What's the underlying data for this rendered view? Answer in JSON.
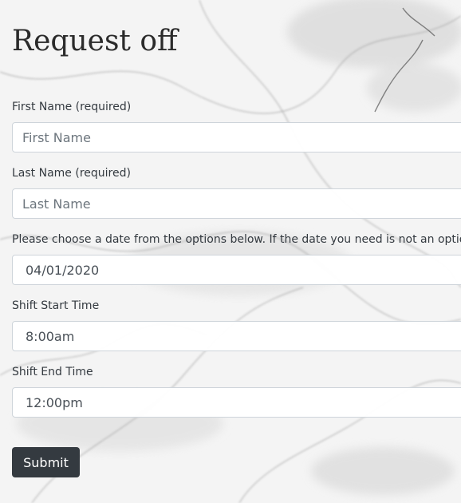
{
  "page": {
    "title": "Request off"
  },
  "form": {
    "first_name": {
      "label": "First Name (required)",
      "placeholder": "First Name",
      "value": ""
    },
    "last_name": {
      "label": "Last Name (required)",
      "placeholder": "Last Name",
      "value": ""
    },
    "date": {
      "label": "Please choose a date from the options below. If the date you need is not an optio",
      "selected": "04/01/2020"
    },
    "shift_start": {
      "label": "Shift Start Time",
      "selected": "8:00am"
    },
    "shift_end": {
      "label": "Shift End Time",
      "selected": "12:00pm"
    },
    "submit_label": "Submit"
  },
  "colors": {
    "button_bg": "#343a40",
    "button_text": "#ffffff",
    "input_border": "#ced4da",
    "label_text": "#343a40"
  }
}
